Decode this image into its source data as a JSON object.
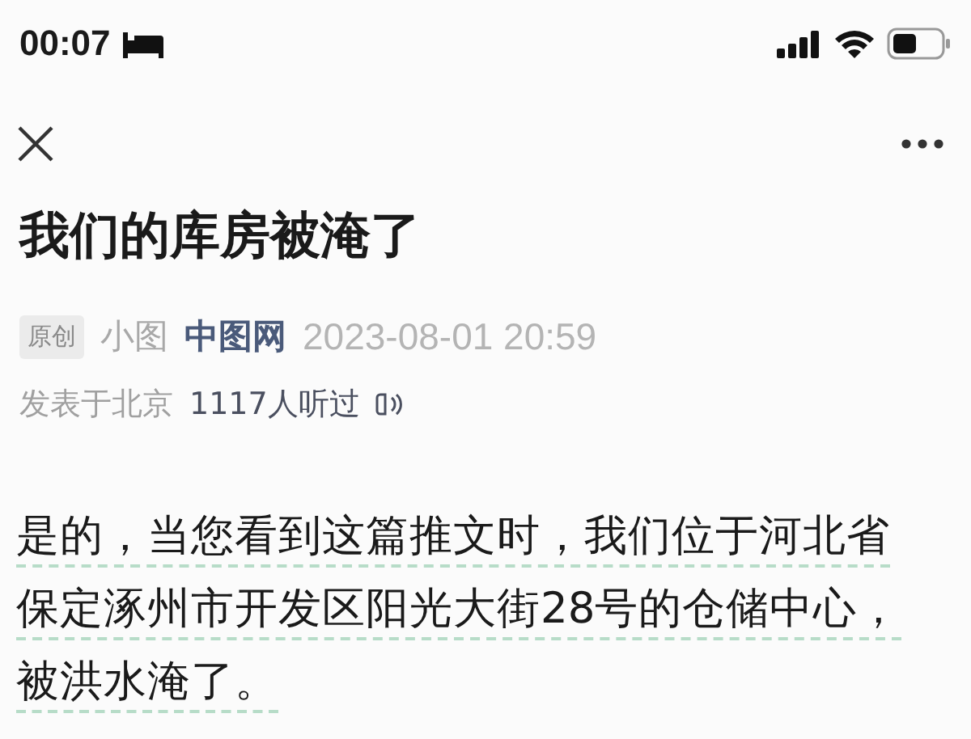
{
  "status_bar": {
    "time": "00:07"
  },
  "article": {
    "title": "我们的库房被淹了",
    "meta": {
      "badge": "原创",
      "author": "小图",
      "account": "中图网",
      "datetime": "2023-08-01 20:59"
    },
    "location": "发表于北京",
    "listens": "1117人听过",
    "body_lines": [
      "是的，当您看到这篇推文时，我们位于河北省",
      "保定涿州市开发区阳光大街28号的仓储中心，",
      "被洪水淹了。"
    ]
  }
}
